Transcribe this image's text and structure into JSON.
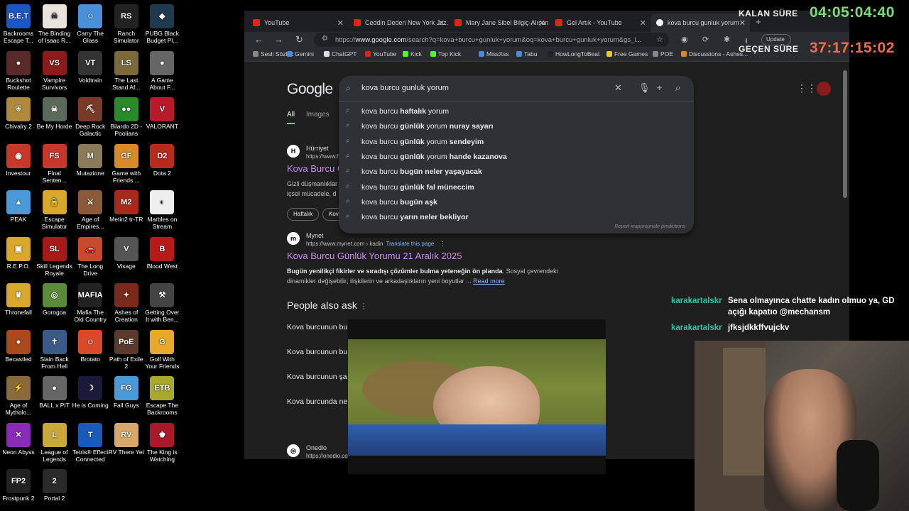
{
  "desktop": {
    "icons": [
      {
        "label": "Backrooms Escape T...",
        "abbr": "B.E.T",
        "color": "#1a56c4"
      },
      {
        "label": "The Binding of Isaac R...",
        "abbr": "☠",
        "color": "#e9e3de"
      },
      {
        "label": "Carry The Glass",
        "abbr": "☺",
        "color": "#4a90d9"
      },
      {
        "label": "Ranch Simulator",
        "abbr": "RS",
        "color": "#222"
      },
      {
        "label": "PUBG Black Budget Pl...",
        "abbr": "◆",
        "color": "#1e3a4c"
      },
      {
        "label": "Buckshot Roulette",
        "abbr": "●",
        "color": "#5a2a2a"
      },
      {
        "label": "Vampire Survivors",
        "abbr": "VS",
        "color": "#8b1a1a"
      },
      {
        "label": "Voidtrain",
        "abbr": "VT",
        "color": "#333"
      },
      {
        "label": "The Last Stand Af...",
        "abbr": "LS",
        "color": "#7a6a3a"
      },
      {
        "label": "A Game About F...",
        "abbr": "●",
        "color": "#666"
      },
      {
        "label": "Chivalry 2",
        "abbr": "⛨",
        "color": "#b08a3a"
      },
      {
        "label": "Be My Horde",
        "abbr": "☠",
        "color": "#5a6a5a"
      },
      {
        "label": "Deep Rock Galactic",
        "abbr": "⛏",
        "color": "#7a3a2a"
      },
      {
        "label": "Bilardo 2D - Poolians",
        "abbr": "●●",
        "color": "#2a8a2a"
      },
      {
        "label": "VALORANT",
        "abbr": "V",
        "color": "#b81a2a"
      },
      {
        "label": "Investour",
        "abbr": "◉",
        "color": "#c8382a"
      },
      {
        "label": "Final Senten...",
        "abbr": "FS",
        "color": "#c8382a"
      },
      {
        "label": "Mutazione",
        "abbr": "M",
        "color": "#8a7a5a"
      },
      {
        "label": "Game with Friends ...",
        "abbr": "GF",
        "color": "#d88a2a"
      },
      {
        "label": "Dota 2",
        "abbr": "D2",
        "color": "#b82a1a"
      },
      {
        "label": "PEAK",
        "abbr": "▲",
        "color": "#4a9ad8"
      },
      {
        "label": "Escape Simulator",
        "abbr": "🔒",
        "color": "#d8a82a"
      },
      {
        "label": "Age of Empires...",
        "abbr": "⚔",
        "color": "#8a5a3a"
      },
      {
        "label": "Metin2 tr-TR",
        "abbr": "M2",
        "color": "#a82a1a"
      },
      {
        "label": "Marbles on Stream",
        "abbr": "◐",
        "color": "#eee"
      },
      {
        "label": "R.E.P.O.",
        "abbr": "▣",
        "color": "#d8a82a"
      },
      {
        "label": "Skill Legends Royale",
        "abbr": "SL",
        "color": "#a81a1a"
      },
      {
        "label": "The Long Drive",
        "abbr": "🚗",
        "color": "#c84a2a"
      },
      {
        "label": "Visage",
        "abbr": "V",
        "color": "#555"
      },
      {
        "label": "Blood West",
        "abbr": "B",
        "color": "#b81a1a"
      },
      {
        "label": "Thronefall",
        "abbr": "♛",
        "color": "#d8a82a"
      },
      {
        "label": "Gorogoa",
        "abbr": "◎",
        "color": "#5a8a3a"
      },
      {
        "label": "Mafia The Old Country",
        "abbr": "MAFIA",
        "color": "#222"
      },
      {
        "label": "Ashes of Creation",
        "abbr": "✦",
        "color": "#7a2a1a"
      },
      {
        "label": "Getting Over It with Ben...",
        "abbr": "⚒",
        "color": "#444"
      },
      {
        "label": "Becastled",
        "abbr": "●",
        "color": "#a84a1a"
      },
      {
        "label": "Slain Back From Hell",
        "abbr": "✝",
        "color": "#3a5a8a"
      },
      {
        "label": "Brotato",
        "abbr": "☺",
        "color": "#d84a2a"
      },
      {
        "label": "Path of Exile 2",
        "abbr": "PoE",
        "color": "#5a3a2a"
      },
      {
        "label": "Golf With Your Friends",
        "abbr": "G",
        "color": "#e8a82a"
      },
      {
        "label": "Age of Mytholo...",
        "abbr": "⚡",
        "color": "#8a6a3a"
      },
      {
        "label": "BALL x PIT",
        "abbr": "●",
        "color": "#666"
      },
      {
        "label": "He is Coming",
        "abbr": "☽",
        "color": "#1a1a3a"
      },
      {
        "label": "Fall Guys",
        "abbr": "FG",
        "color": "#4a9ad8"
      },
      {
        "label": "Escape The Backrooms",
        "abbr": "ETB",
        "color": "#a8a82a"
      },
      {
        "label": "Neon Abyss",
        "abbr": "✕",
        "color": "#8a2ab8"
      },
      {
        "label": "League of Legends",
        "abbr": "L",
        "color": "#c8a83a"
      },
      {
        "label": "Tetris® Effect Connected",
        "abbr": "T",
        "color": "#1a5ab8"
      },
      {
        "label": "RV There Yet",
        "abbr": "RV",
        "color": "#d8a86a"
      },
      {
        "label": "The King is Watching",
        "abbr": "♚",
        "color": "#a81a2a"
      },
      {
        "label": "Frostpunk 2",
        "abbr": "FP2",
        "color": "#222"
      },
      {
        "label": "Portal 2",
        "abbr": "2",
        "color": "#2a2a2a"
      }
    ]
  },
  "browser": {
    "tabs": [
      {
        "title": "YouTube"
      },
      {
        "title": "Ceddin Deden New York Jaz..."
      },
      {
        "title": "Mary Jane Sibel Bilgiç-Alışan"
      },
      {
        "title": "Gel Artık - YouTube"
      },
      {
        "title": "kova burcu gunluk yorum -"
      }
    ],
    "url_scheme": "https://",
    "url_host": "www.google.com",
    "url_rest": "/search?q=kova+burcu+gunluk+yorum&oq=kova+burcu+gunluk+yorum&gs_l...",
    "update_label": "Update",
    "bookmarks": [
      {
        "label": "Sesli Sözlük",
        "color": "#888"
      },
      {
        "label": "Gemini",
        "color": "#4a8ad8"
      },
      {
        "label": "ChatGPT",
        "color": "#ddd"
      },
      {
        "label": "YouTube",
        "color": "#e62117"
      },
      {
        "label": "Kick",
        "color": "#53fc18"
      },
      {
        "label": "Top Kick",
        "color": "#53fc18"
      },
      {
        "label": "MissXss",
        "color": "#4a8ad8"
      },
      {
        "label": "Tabu",
        "color": "#4a8ad8"
      },
      {
        "label": "HowLongToBeat",
        "color": "#222"
      },
      {
        "label": "Free Games",
        "color": "#e8c82a"
      },
      {
        "label": "POE",
        "color": "#888"
      },
      {
        "label": "Discussions - Ashes...",
        "color": "#d8882a"
      }
    ]
  },
  "google": {
    "logo": "Google",
    "query": "kova burcu gunluk yorum",
    "suggestions": [
      {
        "prefix": "kova burcu ",
        "bold": "haftalık",
        "suffix": " yorum"
      },
      {
        "prefix": "kova burcu ",
        "bold": "günlük",
        "suffix": " yorum ",
        "bold2": "nuray sayarı"
      },
      {
        "prefix": "kova burcu ",
        "bold": "günlük",
        "suffix": " yorum ",
        "bold2": "sendeyim"
      },
      {
        "prefix": "kova burcu ",
        "bold": "günlük",
        "suffix": " yorum ",
        "bold2": "hande kazanova"
      },
      {
        "prefix": "kova burcu ",
        "bold": "bugün neler yaşayacak",
        "suffix": "",
        "bold2": ""
      },
      {
        "prefix": "kova burcu ",
        "bold": "günlük fal müneccim",
        "suffix": "",
        "bold2": ""
      },
      {
        "prefix": "kova burcu ",
        "bold": "bugün aşk",
        "suffix": "",
        "bold2": ""
      },
      {
        "prefix": "kova burcu ",
        "bold": "yarın neler bekliyor",
        "suffix": "",
        "bold2": ""
      }
    ],
    "report": "Report inappropriate predictions",
    "filters": [
      "All",
      "Images"
    ],
    "result1": {
      "site": "Hürriyet",
      "url": "https://www.h",
      "title": "Kova Burcu G",
      "snippet1": "Gizli düşmanlıklar",
      "snippet2": "içsel mücadele, d",
      "chips": [
        "Haftalık",
        "Kova"
      ]
    },
    "result2": {
      "site": "Mynet",
      "url": "https://www.mynet.com › kadin",
      "translate": "Translate this page",
      "title": "Kova Burcu Günlük Yorumu 21 Aralık 2025",
      "snippet_bold": "Bugün yenilikçi fikirler ve sıradışı çözümler bulma yeteneğin ön planda",
      "snippet_rest": ". Sosyal çevrendeki dinamikler değişebilir; ilişkilerin ve arkadaşlıkların yeni boyutlar ...",
      "read_more": "Read more"
    },
    "paa_title": "People also ask",
    "paa": [
      "Kova burcunun bu",
      "Kova burcunun bu",
      "Kova burcunun şa",
      "Kova burcunda ne"
    ],
    "result3": {
      "site": "Onedio",
      "url": "https://onedio.co"
    }
  },
  "overlay": {
    "remaining_label": "KALAN SÜRE",
    "remaining_value": "04:05:04:40",
    "elapsed_label": "GEÇEN SÜRE",
    "elapsed_value": "37:17:15:02",
    "remaining_color": "#7dd97a",
    "elapsed_color": "#f26b4a",
    "chat": [
      {
        "user": "karakartalskr",
        "msg": "Sena olmayınca chatte kadın olmuo ya, GD açığı kapatıo @mechansm"
      },
      {
        "user": "karakartalskr",
        "msg": "jfksjdkkffvujckv"
      }
    ]
  }
}
